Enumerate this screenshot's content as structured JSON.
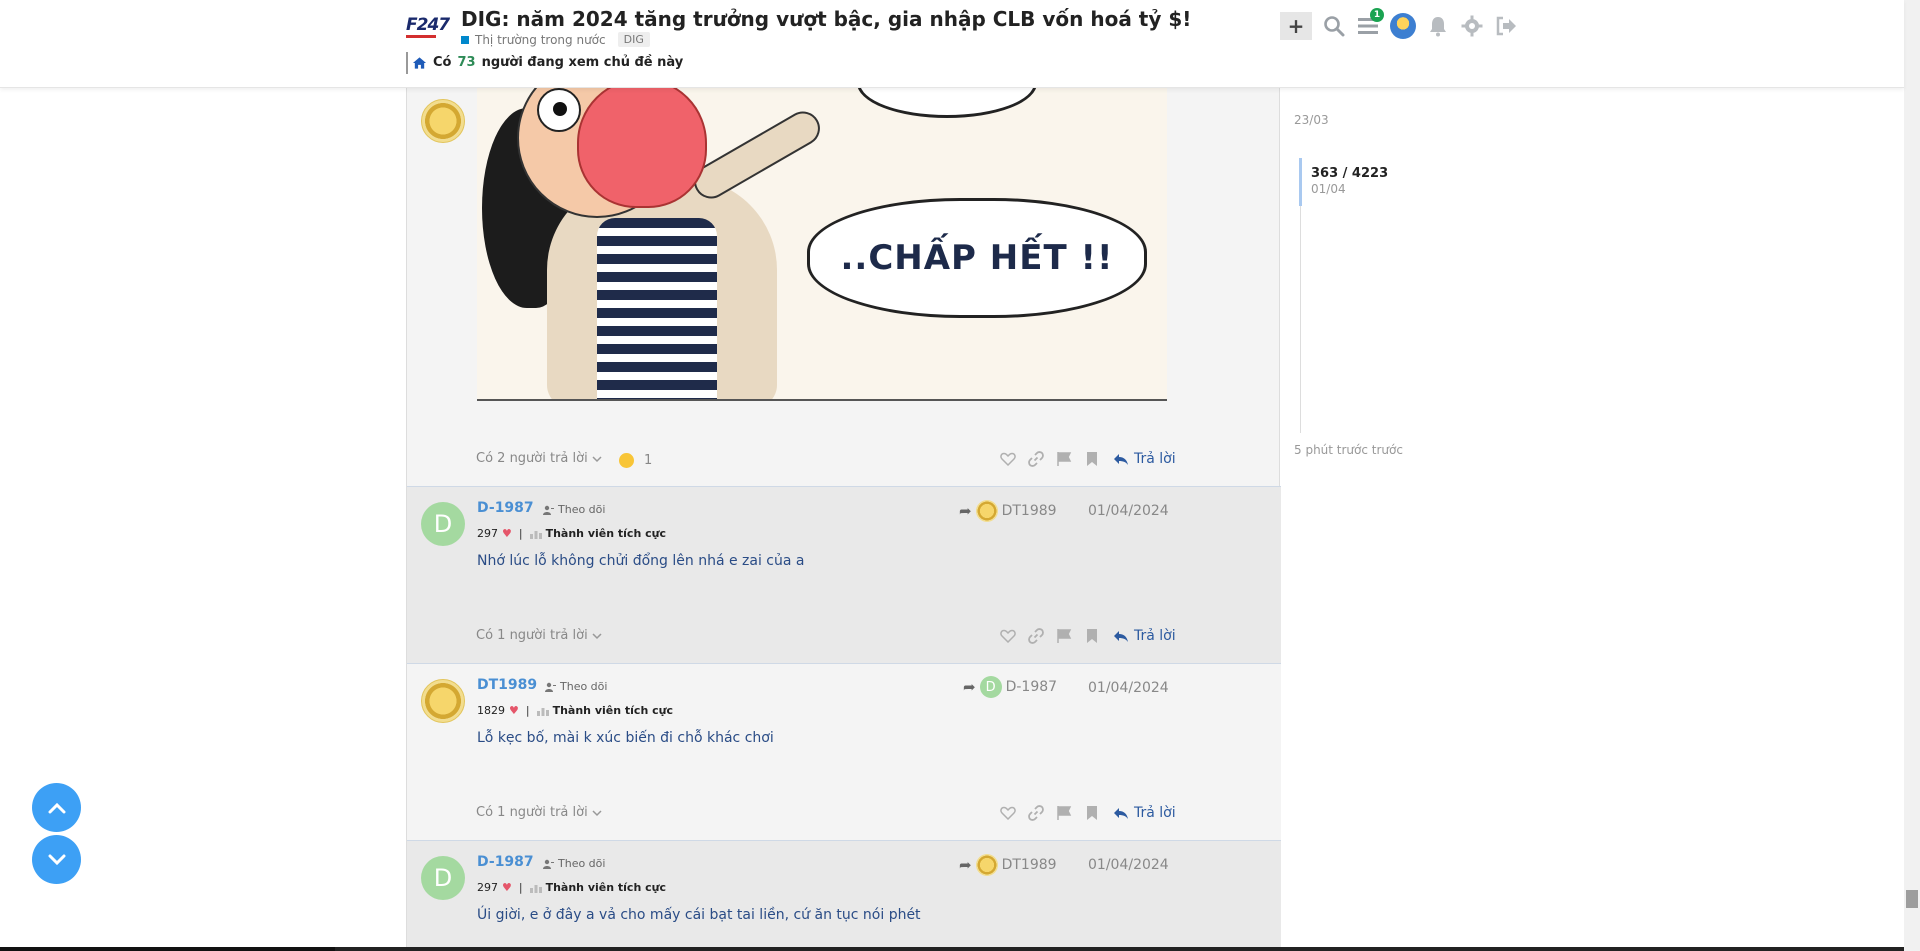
{
  "header": {
    "logo": "F247",
    "title": "DIG: năm 2024 tăng trưởng vượt bậc, gia nhập CLB vốn hoá tỷ $!",
    "category": "Thị trường trong nước",
    "tag": "DIG",
    "viewers_prefix": "Có",
    "viewers_count": "73",
    "viewers_suffix": "người đang xem chủ đề này",
    "new_topic_label": "+",
    "notification_count": "1"
  },
  "top_post": {
    "comic_text": "..CHẤP HẾT !!",
    "replies_label": "Có 2 người trả lời",
    "reaction_count": "1",
    "reply_label": "Trả lời"
  },
  "posts": [
    {
      "username": "D-1987",
      "avatar_letter": "D",
      "follow_label": "Theo dõi",
      "likes": "297",
      "rank": "Thành viên tích cực",
      "reply_to": "DT1989",
      "date": "01/04/2024",
      "body": "Nhớ lúc lỗ không chửi đổng lên nhá e zai của a",
      "replies_label": "Có 1 người trả lời",
      "reply_label": "Trả lời"
    },
    {
      "username": "DT1989",
      "avatar_letter": "",
      "follow_label": "Theo dõi",
      "likes": "1829",
      "rank": "Thành viên tích cực",
      "reply_to": "D-1987",
      "reply_to_letter": "D",
      "date": "01/04/2024",
      "body": "Lỗ kẹc bố, mài k xúc biến đi chỗ khác chơi",
      "replies_label": "Có 1 người trả lời",
      "reply_label": "Trả lời"
    },
    {
      "username": "D-1987",
      "avatar_letter": "D",
      "follow_label": "Theo dõi",
      "likes": "297",
      "rank": "Thành viên tích cực",
      "reply_to": "DT1989",
      "date": "01/04/2024",
      "body": "Úi giời, e ở đây a vả cho mấy cái bạt tai liền, cứ ăn tục nói phét"
    }
  ],
  "timeline": {
    "start": "23/03",
    "position": "363 / 4223",
    "position_date": "01/04",
    "end": "5 phút trước trước"
  },
  "colors": {
    "accent": "#4a8fd3",
    "reply": "#2c5aa0",
    "heart": "#e5566a",
    "float_button": "#3da0f5",
    "viewers_count": "#2e8b57"
  }
}
